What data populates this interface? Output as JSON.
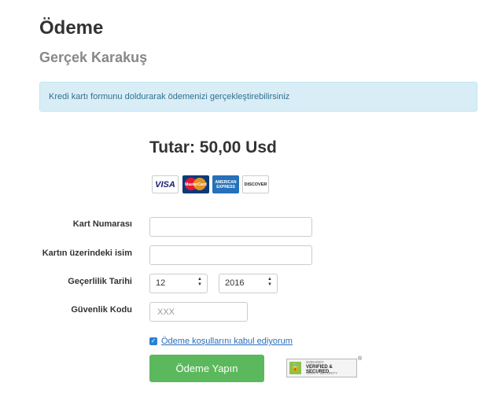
{
  "page": {
    "title": "Ödeme",
    "subtitle": "Gerçek Karakuş",
    "alert": "Kredi kartı formunu doldurarak ödemenizi gerçekleştirebilirsiniz",
    "amount": "Tutar: 50,00 Usd"
  },
  "cards": {
    "visa": "VISA",
    "mastercard": "MasterCard",
    "amex": "AMERICAN EXPRESS",
    "discover": "DISCOVER"
  },
  "form": {
    "card_number_label": "Kart Numarası",
    "card_number_value": "",
    "name_label": "Kartın üzerindeki isim",
    "name_value": "",
    "expiry_label": "Geçerlilik Tarihi",
    "expiry_month": "12",
    "expiry_year": "2016",
    "cvv_label": "Güvenlik Kodu",
    "cvv_placeholder": "XXX",
    "terms_label": "Ödeme koşullarını kabul ediyorum",
    "terms_checked": true,
    "submit_label": "Ödeme Yapın"
  },
  "seal": {
    "brand": "GODADDY",
    "line1": "VERIFIED & SECURED",
    "line2": "VERIFY SECURITY",
    "reg": "®"
  },
  "colors": {
    "alert_bg": "#d9edf7",
    "alert_text": "#31708f",
    "button": "#5cb85c",
    "link": "#2a6ebb"
  }
}
